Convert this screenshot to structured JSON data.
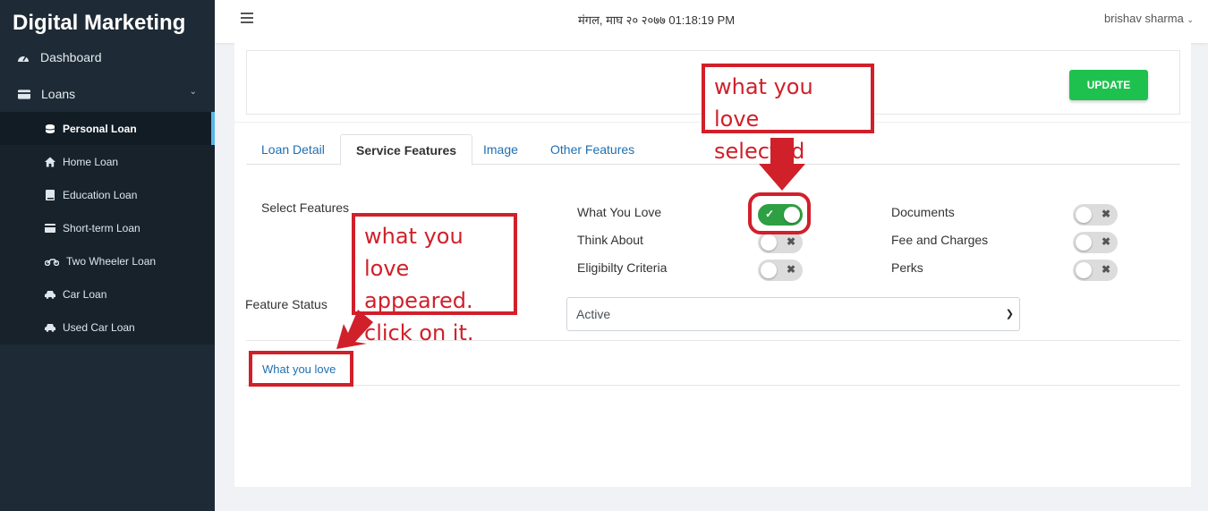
{
  "sidebar": {
    "brand": "Digital Marketing",
    "dashboard_label": "Dashboard",
    "loans_label": "Loans",
    "items": [
      {
        "label": "Personal Loan",
        "icon": "coins-icon"
      },
      {
        "label": "Home Loan",
        "icon": "home-icon"
      },
      {
        "label": "Education Loan",
        "icon": "book-icon"
      },
      {
        "label": "Short-term Loan",
        "icon": "card-icon"
      },
      {
        "label": "Two Wheeler Loan",
        "icon": "motorcycle-icon"
      },
      {
        "label": "Car Loan",
        "icon": "car-icon"
      },
      {
        "label": "Used Car Loan",
        "icon": "car-icon"
      }
    ],
    "active_item": "Personal Loan"
  },
  "header": {
    "datetime": "मंगल, माघ २० २०७७ 01:18:19 PM",
    "user": "brishav sharma"
  },
  "toolbar": {
    "update_label": "UPDATE"
  },
  "tabs": [
    {
      "label": "Loan Detail",
      "active": false
    },
    {
      "label": "Service Features",
      "active": true
    },
    {
      "label": "Image",
      "active": false
    },
    {
      "label": "Other Features",
      "active": false
    }
  ],
  "features": {
    "select_label": "Select Features",
    "left": [
      {
        "name": "What You Love",
        "on": true
      },
      {
        "name": "Think About",
        "on": false
      },
      {
        "name": "Eligibilty Criteria",
        "on": false
      }
    ],
    "right": [
      {
        "name": "Documents",
        "on": false
      },
      {
        "name": "Fee and Charges",
        "on": false
      },
      {
        "name": "Perks",
        "on": false
      }
    ]
  },
  "status": {
    "label": "Feature Status",
    "value": "Active"
  },
  "feature_tabs": [
    {
      "label": "What you love"
    }
  ],
  "annotations": {
    "top": [
      "what you love",
      "selected"
    ],
    "left": [
      "what you love",
      "appeared.",
      "click on it."
    ]
  },
  "colors": {
    "sidebar_bg": "#1e2a35",
    "accent": "#57b8e8",
    "update_green": "#1fc14e",
    "toggle_on": "#2ea043",
    "annotation_red": "#d0202a",
    "link_blue": "#1f6fb0"
  }
}
